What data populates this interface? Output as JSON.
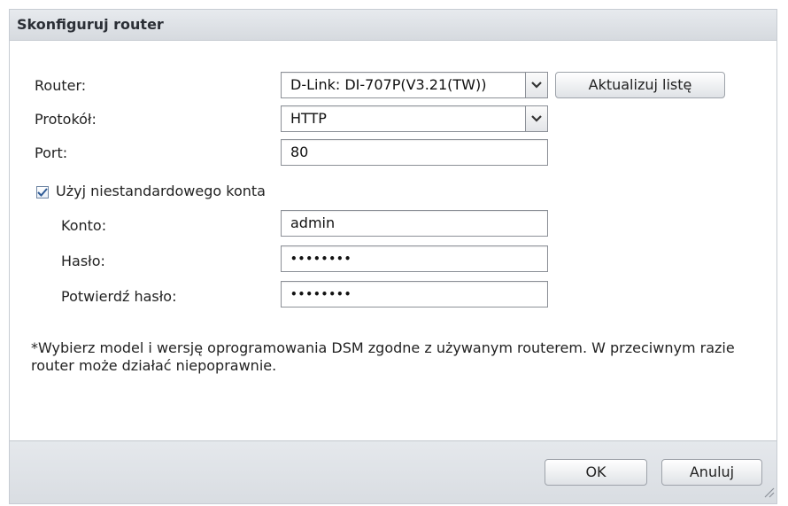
{
  "dialog": {
    "title": "Skonfiguruj router"
  },
  "form": {
    "router_label": "Router:",
    "router_value": "D-Link: DI-707P(V3.21(TW))",
    "update_list_label": "Aktualizuj listę",
    "protocol_label": "Protokół:",
    "protocol_value": "HTTP",
    "port_label": "Port:",
    "port_value": "80",
    "custom_account_label": "Użyj niestandardowego konta",
    "custom_account_checked": true,
    "account_label": "Konto:",
    "account_value": "admin",
    "password_label": "Hasło:",
    "password_masked": "••••••••",
    "confirm_password_label": "Potwierdź hasło:",
    "confirm_password_masked": "••••••••"
  },
  "note": "*Wybierz model i wersję oprogramowania DSM zgodne z używanym routerem. W przeciwnym razie router może działać niepoprawnie.",
  "buttons": {
    "ok": "OK",
    "cancel": "Anuluj"
  },
  "icons": {
    "dropdown": "chevron-down-icon",
    "check": "check-icon",
    "resize": "resize-grip-icon"
  },
  "colors": {
    "titlebar": "#dde1e6",
    "border": "#8c9097",
    "checkbox_tick": "#2f5b96"
  }
}
